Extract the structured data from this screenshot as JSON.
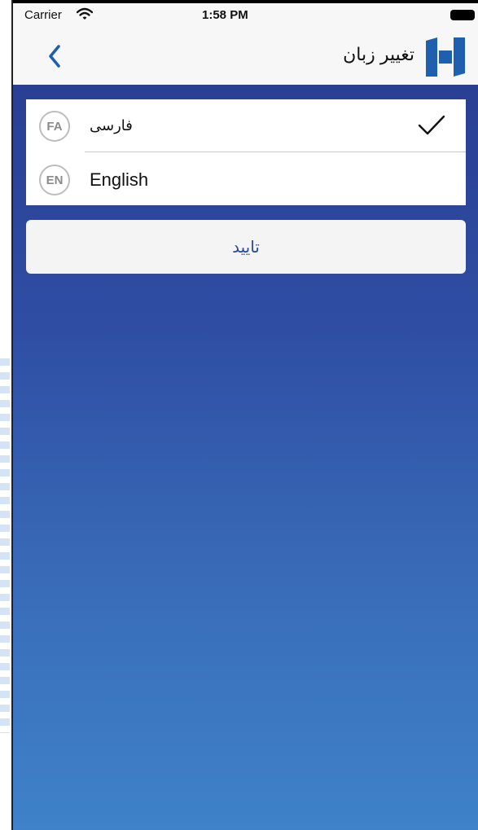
{
  "status_bar": {
    "carrier": "Carrier",
    "time": "1:58 PM"
  },
  "nav": {
    "title": "تغییر زبان",
    "back_icon": "chevron-left-icon",
    "logo_icon": "bank-logo-icon"
  },
  "languages": [
    {
      "code": "FA",
      "label": "فارسی",
      "selected": true
    },
    {
      "code": "EN",
      "label": "English",
      "selected": false
    }
  ],
  "confirm_label": "تایید",
  "colors": {
    "accent": "#2b4a9e",
    "gradient_top": "#293f94",
    "gradient_bottom": "#3f82c9",
    "logo_blue": "#1f5fb0"
  }
}
